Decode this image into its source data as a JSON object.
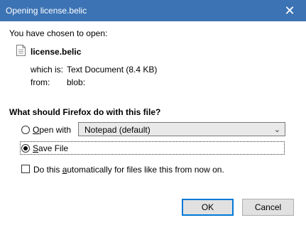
{
  "window": {
    "title": "Opening license.belic",
    "close_glyph": "✕"
  },
  "intro": "You have chosen to open:",
  "file": {
    "name": "license.belic",
    "which_is_label": "which is:",
    "which_is_value": "Text Document (8.4 KB)",
    "from_label": "from:",
    "from_value": "blob:",
    "icon": "document-icon"
  },
  "question": "What should Firefox do with this file?",
  "options": {
    "open_with": {
      "prefix": "",
      "mnemonic": "O",
      "rest": "pen with",
      "selected": false
    },
    "app_select": {
      "value": "Notepad (default)",
      "icon": "chevron-down-icon"
    },
    "save_file": {
      "mnemonic": "S",
      "rest": "ave File",
      "selected": true
    },
    "auto": {
      "prefix": "Do this ",
      "mnemonic": "a",
      "rest": "utomatically for files like this from now on.",
      "checked": false
    }
  },
  "buttons": {
    "ok": "OK",
    "cancel": "Cancel"
  },
  "colors": {
    "titlebar": "#3c73b4",
    "accent": "#0078d7"
  }
}
